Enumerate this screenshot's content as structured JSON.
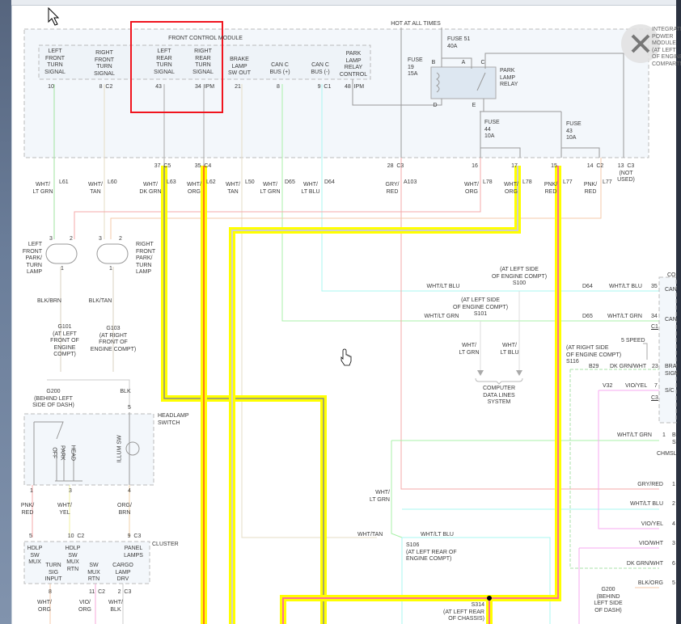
{
  "ipm": {
    "title": "INTEGRATED\nPOWER\nMODULE\n(AT LEFT\nOF ENGINE\nCOMPARTMENT)",
    "hot": "HOT AT ALL TIMES",
    "fuse51": "FUSE 51\n40A",
    "fuse19": "FUSE\n19\n15A",
    "fuse44": "FUSE\n44\n10A",
    "fuse43": "FUSE\n43\n10A",
    "relay": "PARK\nLAMP\nRELAY",
    "relay_pins": [
      "B",
      "A",
      "C",
      "D",
      "E"
    ],
    "out_pins": [
      "28  C3",
      "16",
      "17",
      "15",
      "14  C2",
      "13  C3\n(NOT\nUSED)"
    ]
  },
  "fcm": {
    "title": "FRONT CONTROL MODULE",
    "circuits": [
      "LEFT\nFRONT\nTURN\nSIGNAL",
      "RIGHT\nFRONT\nTURN\nSIGNAL",
      "LEFT\nREAR\nTURN\nSIGNAL",
      "RIGHT\nREAR\nTURN\nSIGNAL",
      "BRAKE\nLAMP\nSW OUT",
      "CAN C\nBUS (+)",
      "CAN C\nBUS (-)",
      "PARK\nLAMP\nRELAY\nCONTROL"
    ],
    "pins": [
      "10",
      "8  C2",
      "43",
      "34  IPM",
      "21",
      "8",
      "9  C1",
      "48  IPM"
    ],
    "out_pins": [
      "37  C5",
      "35  C4"
    ]
  },
  "wires_top": [
    {
      "color": "WHT/\nLT GRN",
      "id": "L61"
    },
    {
      "color": "WHT/\nTAN",
      "id": "L60"
    },
    {
      "color": "WHT/\nDK GRN",
      "id": "L63"
    },
    {
      "color": "WHT/\nORG",
      "id": "L62"
    },
    {
      "color": "WHT/\nTAN",
      "id": "L50"
    },
    {
      "color": "WHT/\nLT GRN",
      "id": "D65"
    },
    {
      "color": "WHT/\nLT BLU",
      "id": "D64"
    },
    {
      "color": "GRY/\nRED",
      "id": "A103"
    },
    {
      "color": "WHT/\nORG",
      "id": "L78"
    },
    {
      "color": "WHT/\nORG",
      "id": "L78"
    },
    {
      "color": "PNK/\nRED",
      "id": "L77"
    },
    {
      "color": "PNK/\nRED",
      "id": "L77"
    }
  ],
  "lamps": {
    "left": "LEFT\nFRONT\nPARK/\nTURN\nLAMP",
    "right": "RIGHT\nFRONT\nPARK/\nTURN\nLAMP",
    "pins": [
      "3",
      "2",
      "1",
      "3",
      "2",
      "1"
    ],
    "left_wire": "BLK/BRN",
    "right_wire": "BLK/TAN",
    "g101": "G101\n(AT LEFT\nFRONT OF\nENGINE\nCOMPT)",
    "g103": "G103\n(AT RIGHT\nFRONT OF\nENGINE COMPT)"
  },
  "headlamp": {
    "ground": "G200\n(BEHIND LEFT\nSIDE OF DASH)",
    "blk": "BLK",
    "pin5": "5",
    "title": "HEADLAMP\nSWITCH",
    "positions": [
      "OFF",
      "PARK",
      "HEAD"
    ],
    "illum": "ILLUM SW",
    "pins": [
      "1",
      "3",
      "4"
    ],
    "wires": [
      "PNK/\nRED",
      "WHT/\nYEL",
      "ORG/\nBRN"
    ]
  },
  "cluster": {
    "title": "CLUSTER",
    "pins_top": [
      "5",
      "10  C2",
      "9  C3"
    ],
    "circuits": [
      "HDLP\nSW\nMUX",
      "HDLP\nSW\nMUX\nRTN",
      "PANEL\nLAMPS",
      "TURN\nSIG\nINPUT",
      "SW\nMUX\nRTN",
      "CARGO\nLAMP\nDRV"
    ],
    "pins_bottom": [
      "8",
      "11  C2",
      "2  C3"
    ],
    "wires": [
      "WHT/\nORG",
      "VIO/\nORG",
      "WHT/\nBLK"
    ]
  },
  "splices": {
    "s100": "(AT LEFT SIDE\nOF ENGINE COMPT)\nS100",
    "s101": "(AT LEFT SIDE\nOF ENGINE COMPT)\nS101",
    "s116": "(AT RIGHT SIDE\nOF ENGINE COMPT)\nS116",
    "s106": "S106\n(AT LEFT REAR OF\nENGINE COMPT)",
    "s314": "S314\n(AT LEFT REAR\nOF CHASSIS)",
    "g200b": "G200\n(BEHIND\nLEFT SIDE\nOF DASH)"
  },
  "mid": {
    "wht_lt_blu": "WHT/LT BLU",
    "wht_lt_grn": "WHT/LT GRN",
    "drop_grn": "WHT/\nLT GRN",
    "drop_blu": "WHT/\nLT BLU",
    "cdl": "COMPUTER\nDATA LINES\nSYSTEM",
    "wht_lt_grn2": "WHT/\nLT GRN",
    "wht_tan": "WHT/TAN",
    "wht_lt_blu2": "WHT/LT BLU"
  },
  "right": {
    "d64": "D64",
    "d64c": "WHT/LT BLU",
    "p35": "35",
    "d65": "D65",
    "d65c": "WHT/LT GRN",
    "p34": "34",
    "c1": "C1",
    "speed": "5 SPEED",
    "b29": "B29",
    "b29c": "DK GRN/WHT",
    "p23": "23",
    "v32": "V32",
    "v32c": "VIO/YEL",
    "p7": "7",
    "c3": "C3",
    "mod_frags": [
      "CO",
      "CAN",
      "CAN",
      "BRA\nSIGN",
      "S/C"
    ],
    "chmsl_wire": "WHT/LT GRN",
    "chmsl_pin": "1",
    "chmsl_frag": "B\nS",
    "chmsl": "CHMSL",
    "lower": [
      {
        "color": "GRY/RED",
        "pin": "1"
      },
      {
        "color": "WHT/LT BLU",
        "pin": "2"
      },
      {
        "color": "VIO/YEL",
        "pin": "4"
      },
      {
        "color": "VIO/WHT",
        "pin": "3"
      },
      {
        "color": "DK GRN/WHT",
        "pin": "6"
      },
      {
        "color": "BLK/ORG",
        "pin": "5"
      }
    ]
  },
  "colors": {
    "highlight_box": "#f0141e",
    "highlight_wire": "#ffff00"
  }
}
